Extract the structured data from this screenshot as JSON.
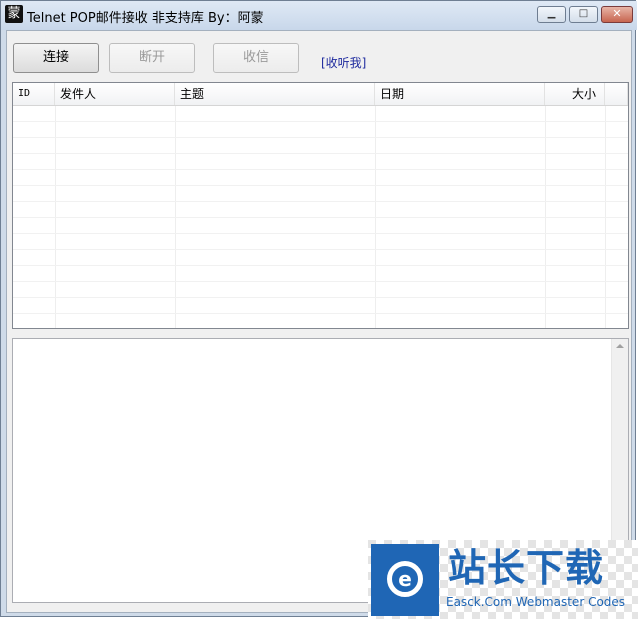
{
  "window": {
    "app_icon": "蒙",
    "title": "Telnet POP邮件接收 非支持库 By：阿蒙",
    "icons": {
      "minimize": "minimize-icon",
      "maximize": "maximize-icon",
      "close": "close-icon"
    }
  },
  "toolbar": {
    "connect_label": "连接",
    "disconnect_label": "断开",
    "receive_label": "收信",
    "about_link": "[收听我]"
  },
  "listview": {
    "columns": [
      "ID",
      "发件人",
      "主题",
      "日期",
      "大小"
    ],
    "rows": []
  },
  "message_box": {
    "value": ""
  },
  "watermark": {
    "logo_letter": "e",
    "title": "站长下载",
    "subtitle": "Easck.Com Webmaster Codes"
  }
}
